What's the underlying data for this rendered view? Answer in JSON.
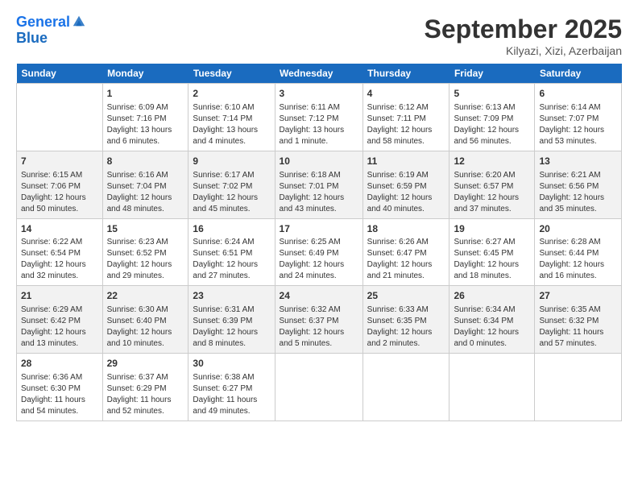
{
  "header": {
    "logo_line1": "General",
    "logo_line2": "Blue",
    "month": "September 2025",
    "location": "Kilyazi, Xizi, Azerbaijan"
  },
  "weekdays": [
    "Sunday",
    "Monday",
    "Tuesday",
    "Wednesday",
    "Thursday",
    "Friday",
    "Saturday"
  ],
  "weeks": [
    [
      {
        "day": "",
        "info": ""
      },
      {
        "day": "1",
        "info": "Sunrise: 6:09 AM\nSunset: 7:16 PM\nDaylight: 13 hours\nand 6 minutes."
      },
      {
        "day": "2",
        "info": "Sunrise: 6:10 AM\nSunset: 7:14 PM\nDaylight: 13 hours\nand 4 minutes."
      },
      {
        "day": "3",
        "info": "Sunrise: 6:11 AM\nSunset: 7:12 PM\nDaylight: 13 hours\nand 1 minute."
      },
      {
        "day": "4",
        "info": "Sunrise: 6:12 AM\nSunset: 7:11 PM\nDaylight: 12 hours\nand 58 minutes."
      },
      {
        "day": "5",
        "info": "Sunrise: 6:13 AM\nSunset: 7:09 PM\nDaylight: 12 hours\nand 56 minutes."
      },
      {
        "day": "6",
        "info": "Sunrise: 6:14 AM\nSunset: 7:07 PM\nDaylight: 12 hours\nand 53 minutes."
      }
    ],
    [
      {
        "day": "7",
        "info": "Sunrise: 6:15 AM\nSunset: 7:06 PM\nDaylight: 12 hours\nand 50 minutes."
      },
      {
        "day": "8",
        "info": "Sunrise: 6:16 AM\nSunset: 7:04 PM\nDaylight: 12 hours\nand 48 minutes."
      },
      {
        "day": "9",
        "info": "Sunrise: 6:17 AM\nSunset: 7:02 PM\nDaylight: 12 hours\nand 45 minutes."
      },
      {
        "day": "10",
        "info": "Sunrise: 6:18 AM\nSunset: 7:01 PM\nDaylight: 12 hours\nand 43 minutes."
      },
      {
        "day": "11",
        "info": "Sunrise: 6:19 AM\nSunset: 6:59 PM\nDaylight: 12 hours\nand 40 minutes."
      },
      {
        "day": "12",
        "info": "Sunrise: 6:20 AM\nSunset: 6:57 PM\nDaylight: 12 hours\nand 37 minutes."
      },
      {
        "day": "13",
        "info": "Sunrise: 6:21 AM\nSunset: 6:56 PM\nDaylight: 12 hours\nand 35 minutes."
      }
    ],
    [
      {
        "day": "14",
        "info": "Sunrise: 6:22 AM\nSunset: 6:54 PM\nDaylight: 12 hours\nand 32 minutes."
      },
      {
        "day": "15",
        "info": "Sunrise: 6:23 AM\nSunset: 6:52 PM\nDaylight: 12 hours\nand 29 minutes."
      },
      {
        "day": "16",
        "info": "Sunrise: 6:24 AM\nSunset: 6:51 PM\nDaylight: 12 hours\nand 27 minutes."
      },
      {
        "day": "17",
        "info": "Sunrise: 6:25 AM\nSunset: 6:49 PM\nDaylight: 12 hours\nand 24 minutes."
      },
      {
        "day": "18",
        "info": "Sunrise: 6:26 AM\nSunset: 6:47 PM\nDaylight: 12 hours\nand 21 minutes."
      },
      {
        "day": "19",
        "info": "Sunrise: 6:27 AM\nSunset: 6:45 PM\nDaylight: 12 hours\nand 18 minutes."
      },
      {
        "day": "20",
        "info": "Sunrise: 6:28 AM\nSunset: 6:44 PM\nDaylight: 12 hours\nand 16 minutes."
      }
    ],
    [
      {
        "day": "21",
        "info": "Sunrise: 6:29 AM\nSunset: 6:42 PM\nDaylight: 12 hours\nand 13 minutes."
      },
      {
        "day": "22",
        "info": "Sunrise: 6:30 AM\nSunset: 6:40 PM\nDaylight: 12 hours\nand 10 minutes."
      },
      {
        "day": "23",
        "info": "Sunrise: 6:31 AM\nSunset: 6:39 PM\nDaylight: 12 hours\nand 8 minutes."
      },
      {
        "day": "24",
        "info": "Sunrise: 6:32 AM\nSunset: 6:37 PM\nDaylight: 12 hours\nand 5 minutes."
      },
      {
        "day": "25",
        "info": "Sunrise: 6:33 AM\nSunset: 6:35 PM\nDaylight: 12 hours\nand 2 minutes."
      },
      {
        "day": "26",
        "info": "Sunrise: 6:34 AM\nSunset: 6:34 PM\nDaylight: 12 hours\nand 0 minutes."
      },
      {
        "day": "27",
        "info": "Sunrise: 6:35 AM\nSunset: 6:32 PM\nDaylight: 11 hours\nand 57 minutes."
      }
    ],
    [
      {
        "day": "28",
        "info": "Sunrise: 6:36 AM\nSunset: 6:30 PM\nDaylight: 11 hours\nand 54 minutes."
      },
      {
        "day": "29",
        "info": "Sunrise: 6:37 AM\nSunset: 6:29 PM\nDaylight: 11 hours\nand 52 minutes."
      },
      {
        "day": "30",
        "info": "Sunrise: 6:38 AM\nSunset: 6:27 PM\nDaylight: 11 hours\nand 49 minutes."
      },
      {
        "day": "",
        "info": ""
      },
      {
        "day": "",
        "info": ""
      },
      {
        "day": "",
        "info": ""
      },
      {
        "day": "",
        "info": ""
      }
    ]
  ]
}
